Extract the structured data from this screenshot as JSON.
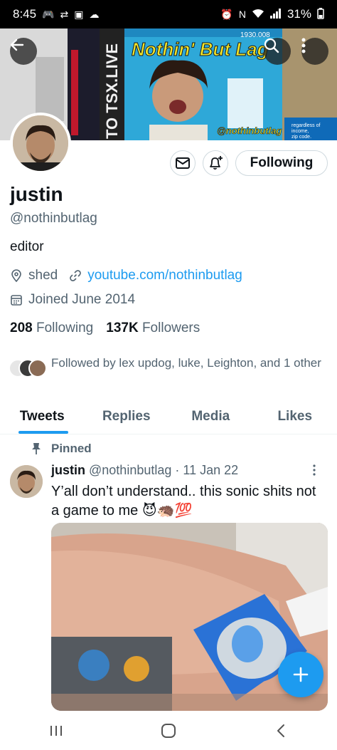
{
  "status_bar": {
    "time": "8:45",
    "battery": "31%"
  },
  "banner": {
    "sign_title": "Nothin' But Lag",
    "sign_handle": "@nothinbutlag",
    "side_text": "TO TSX.LIVE",
    "price_tag": "1930.008",
    "small_note_1": "regardless of",
    "small_note_2": "income,",
    "small_note_3": "zip code."
  },
  "profile": {
    "display_name": "justin",
    "handle": "@nothinbutlag",
    "bio": "editor",
    "location": "shed",
    "website": "youtube.com/nothinbutlag",
    "joined": "Joined June 2014",
    "following_count": "208",
    "following_label": "Following",
    "followers_count": "137K",
    "followers_label": "Followers",
    "followed_by": "Followed by lex updog, luke, Leighton, and 1 other",
    "follow_button": "Following"
  },
  "tabs": [
    {
      "label": "Tweets",
      "active": true
    },
    {
      "label": "Replies",
      "active": false
    },
    {
      "label": "Media",
      "active": false
    },
    {
      "label": "Likes",
      "active": false
    }
  ],
  "tweet": {
    "pinned_label": "Pinned",
    "name": "justin",
    "handle": "@nothinbutlag",
    "separator": "·",
    "date": "11 Jan 22",
    "text": "Y’all don’t understand.. this sonic shits not a game to me 😈🦔💯"
  },
  "colors": {
    "accent": "#1d9bf0",
    "text_primary": "#0f1419",
    "text_secondary": "#536471"
  }
}
